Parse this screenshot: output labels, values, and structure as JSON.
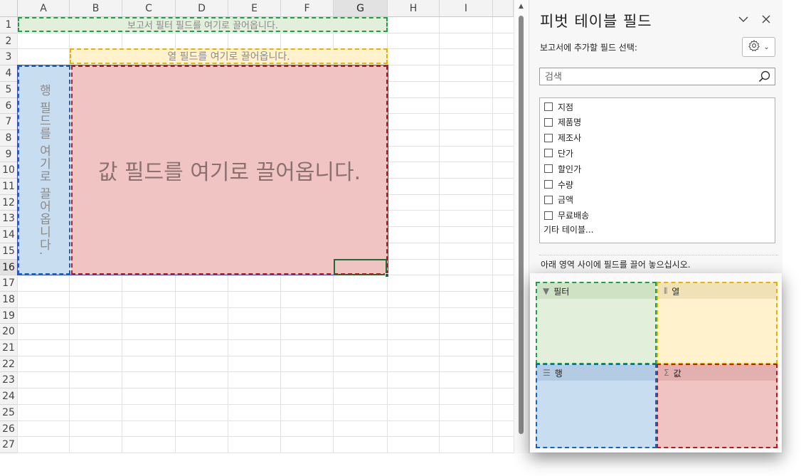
{
  "sheet": {
    "columns": [
      "A",
      "B",
      "C",
      "D",
      "E",
      "F",
      "G",
      "H",
      "I"
    ],
    "rows": [
      "1",
      "2",
      "3",
      "4",
      "5",
      "6",
      "7",
      "8",
      "9",
      "10",
      "11",
      "12",
      "13",
      "14",
      "15",
      "16",
      "17",
      "18",
      "19",
      "20",
      "21",
      "22",
      "23",
      "24",
      "25",
      "26",
      "27"
    ],
    "selected_column": "G",
    "selected_row": "16"
  },
  "pivot_placeholders": {
    "filter": "보고서 필터 필드를 여기로 끌어옵니다.",
    "column": "열 필드를 여기로 끌어옵니다.",
    "row": "행 필드를 여기로 끌어옵니다.",
    "values": "값 필드를 여기로 끌어옵니다."
  },
  "pane": {
    "title": "피벗 테이블 필드",
    "subtitle": "보고서에 추가할 필드 선택:",
    "search_placeholder": "검색",
    "fields": [
      "지점",
      "제품명",
      "제조사",
      "단가",
      "할인가",
      "수량",
      "금액",
      "무료배송"
    ],
    "more_tables": "기타 테이블...",
    "areas_hint": "아래 영역 사이에 필드를 끌어 놓으십시오.",
    "areas": {
      "filter": "필터",
      "columns": "열",
      "rows": "행",
      "values": "값"
    }
  },
  "colors": {
    "filter": "#1e9e4a",
    "column": "#e4b400",
    "row": "#1565c0",
    "values": "#b71c1c"
  }
}
